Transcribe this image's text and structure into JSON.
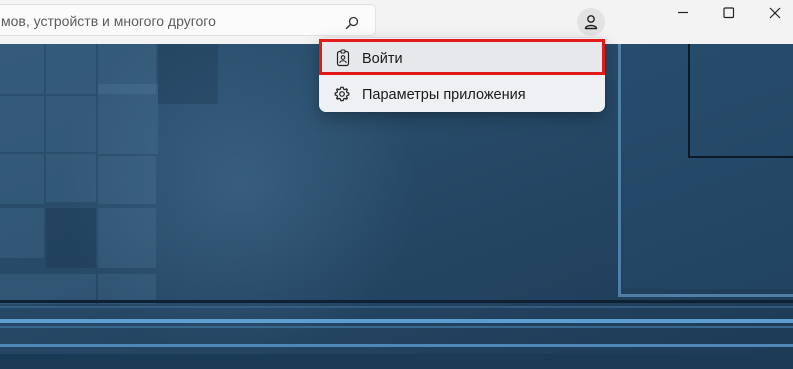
{
  "search": {
    "visible_text": "мов, устройств и многого другого",
    "icon": "search-icon"
  },
  "account": {
    "icon": "person-icon"
  },
  "window_controls": {
    "minimize_icon": "minimize-icon",
    "maximize_icon": "maximize-icon",
    "close_icon": "close-icon"
  },
  "account_menu": {
    "items": [
      {
        "label": "Войти",
        "icon": "badge-icon",
        "highlighted": true,
        "highlight_color": "#e11a1a"
      },
      {
        "label": "Параметры приложения",
        "icon": "gear-icon",
        "highlighted": false
      }
    ]
  },
  "colors": {
    "topbar": "#f3f3f3",
    "menu_background": "#eef0f3",
    "highlight": "#e11a1a",
    "background_art": "#274a68"
  }
}
